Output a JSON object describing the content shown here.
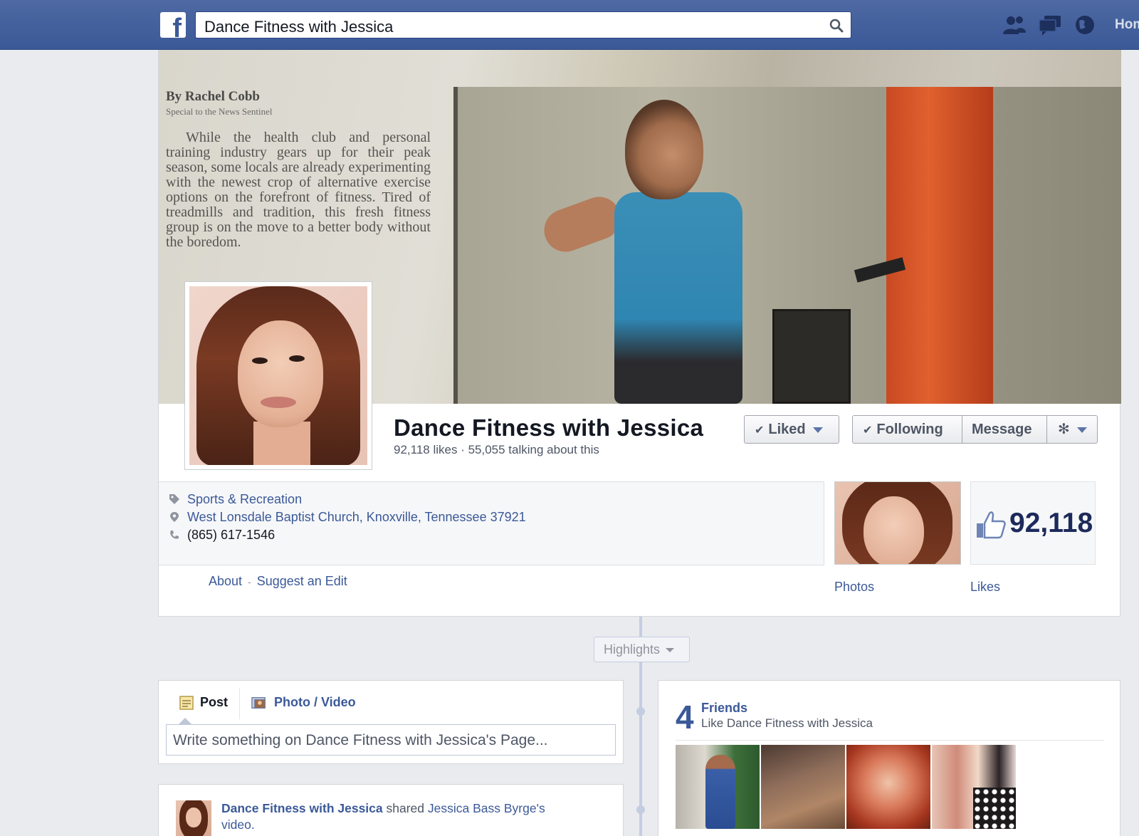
{
  "topbar": {
    "logo": "f",
    "search_value": "Dance Fitness with Jessica",
    "home_label": "Hom"
  },
  "cover": {
    "byline": "By Rachel Cobb",
    "byline_sub": "Special to the News Sentinel",
    "article_text": "While the health club and personal training industry gears up for their peak season, some locals are already experimenting with the newest crop of alternative exercise options on the forefront of fitness. Tired of treadmills and tradition, this fresh fitness group is on the move to a better body without the boredom."
  },
  "page": {
    "name": "Dance Fitness with Jessica",
    "stats": "92,118 likes · 55,055 talking about this"
  },
  "actions": {
    "liked_label": "Liked",
    "following_label": "Following",
    "message_label": "Message"
  },
  "info": {
    "category": "Sports & Recreation",
    "address": "West Lonsdale Baptist Church, Knoxville, Tennessee 37921",
    "phone": "(865) 617-1546",
    "about_link": "About",
    "suggest_edit_link": "Suggest an Edit",
    "separator": "-"
  },
  "apps": {
    "photos_label": "Photos",
    "likes_label": "Likes",
    "likes_count": "92,118"
  },
  "timeline": {
    "highlights_label": "Highlights"
  },
  "composer": {
    "post_tab": "Post",
    "photo_video_tab": "Photo / Video",
    "placeholder": "Write something on Dance Fitness with Jessica's Page..."
  },
  "story": {
    "actor": "Dance Fitness with Jessica",
    "verb": "shared",
    "target": "Jessica Bass Byrge's",
    "object": "video."
  },
  "friends": {
    "count": "4",
    "title": "Friends",
    "subtitle": "Like Dance Fitness with Jessica"
  },
  "colors": {
    "brand": "#3b5998",
    "link": "#3b5998",
    "background": "#e9ebee"
  }
}
